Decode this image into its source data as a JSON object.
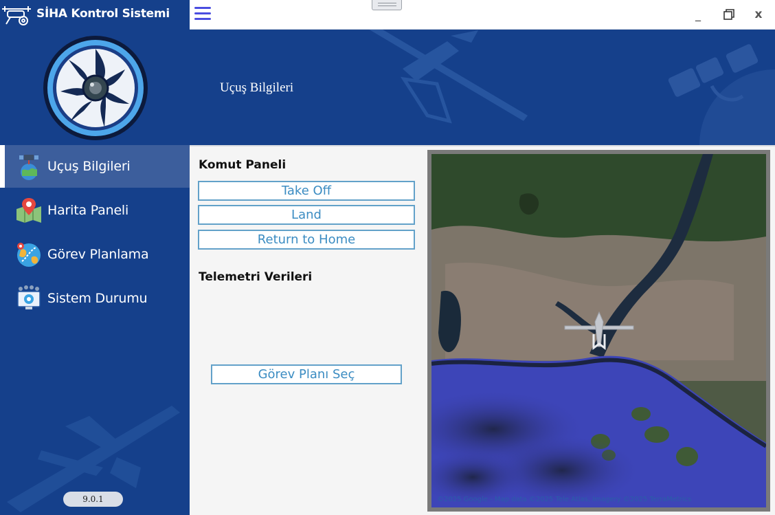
{
  "app": {
    "title": "SİHA Kontrol Sistemi",
    "version": "9.0.1"
  },
  "sidebar": {
    "items": [
      {
        "label": "Uçuş Bilgileri",
        "icon": "satellite-earth-icon",
        "active": true
      },
      {
        "label": "Harita Paneli",
        "icon": "map-pin-icon",
        "active": false
      },
      {
        "label": "Görev Planlama",
        "icon": "globe-route-icon",
        "active": false
      },
      {
        "label": "Sistem Durumu",
        "icon": "monitor-gear-icon",
        "active": false
      }
    ]
  },
  "titlebar": {
    "minimize": "_",
    "close": "x"
  },
  "banner": {
    "title": "Uçuş Bilgileri"
  },
  "command_panel": {
    "title": "Komut Paneli",
    "takeoff": "Take Off",
    "land": "Land",
    "return_home": "Return to Home"
  },
  "telemetry": {
    "title": "Telemetri Verileri",
    "mission_plan_button": "Görev Planı Seç"
  },
  "map": {
    "attribution": "©2025 Google - Map data ©2025 Tele Atlas, Imagery ©2025 TerraMetrics"
  },
  "colors": {
    "sidebar_bg": "#15408b",
    "active_item_bg": "#3c5e9c",
    "button_border": "#62a1c9",
    "button_text": "#3b8cc2",
    "content_bg": "#f5f5f5"
  }
}
